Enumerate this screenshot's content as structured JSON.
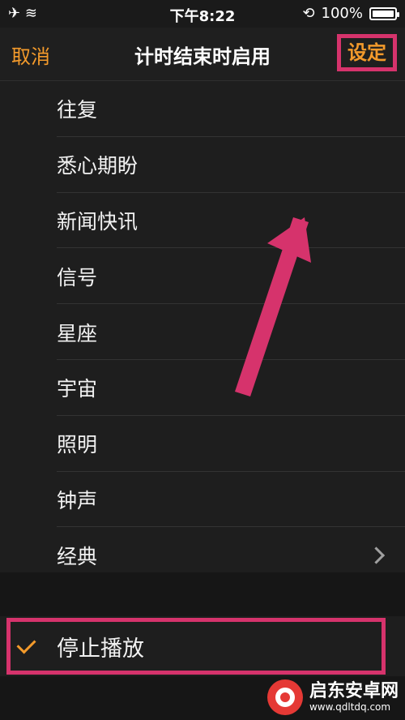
{
  "status_bar": {
    "left": "✈ ≋",
    "time": "下午8:22",
    "battery_text": "100%",
    "battery_level": 1.0
  },
  "nav": {
    "cancel": "取消",
    "title": "计时结束时启用",
    "set": "设定"
  },
  "list": {
    "items": [
      {
        "label": "往复"
      },
      {
        "label": "悉心期盼"
      },
      {
        "label": "新闻快讯"
      },
      {
        "label": "信号"
      },
      {
        "label": "星座"
      },
      {
        "label": "宇宙"
      },
      {
        "label": "照明"
      },
      {
        "label": "钟声"
      },
      {
        "label": "经典"
      }
    ]
  },
  "stop": {
    "label": "停止播放",
    "selected": true
  },
  "watermark": {
    "name": "启东安卓网",
    "url": "www.qdltdq.com"
  },
  "colors": {
    "accent": "#f39a2b",
    "highlight": "#d6336c",
    "background": "#1a1a1a"
  },
  "icons": {
    "airplane": "airplane-icon",
    "wifi": "wifi-icon",
    "rotation_lock": "rotation-lock-icon",
    "battery": "battery-icon",
    "chevron": "chevron-right-icon",
    "check": "checkmark-icon"
  }
}
